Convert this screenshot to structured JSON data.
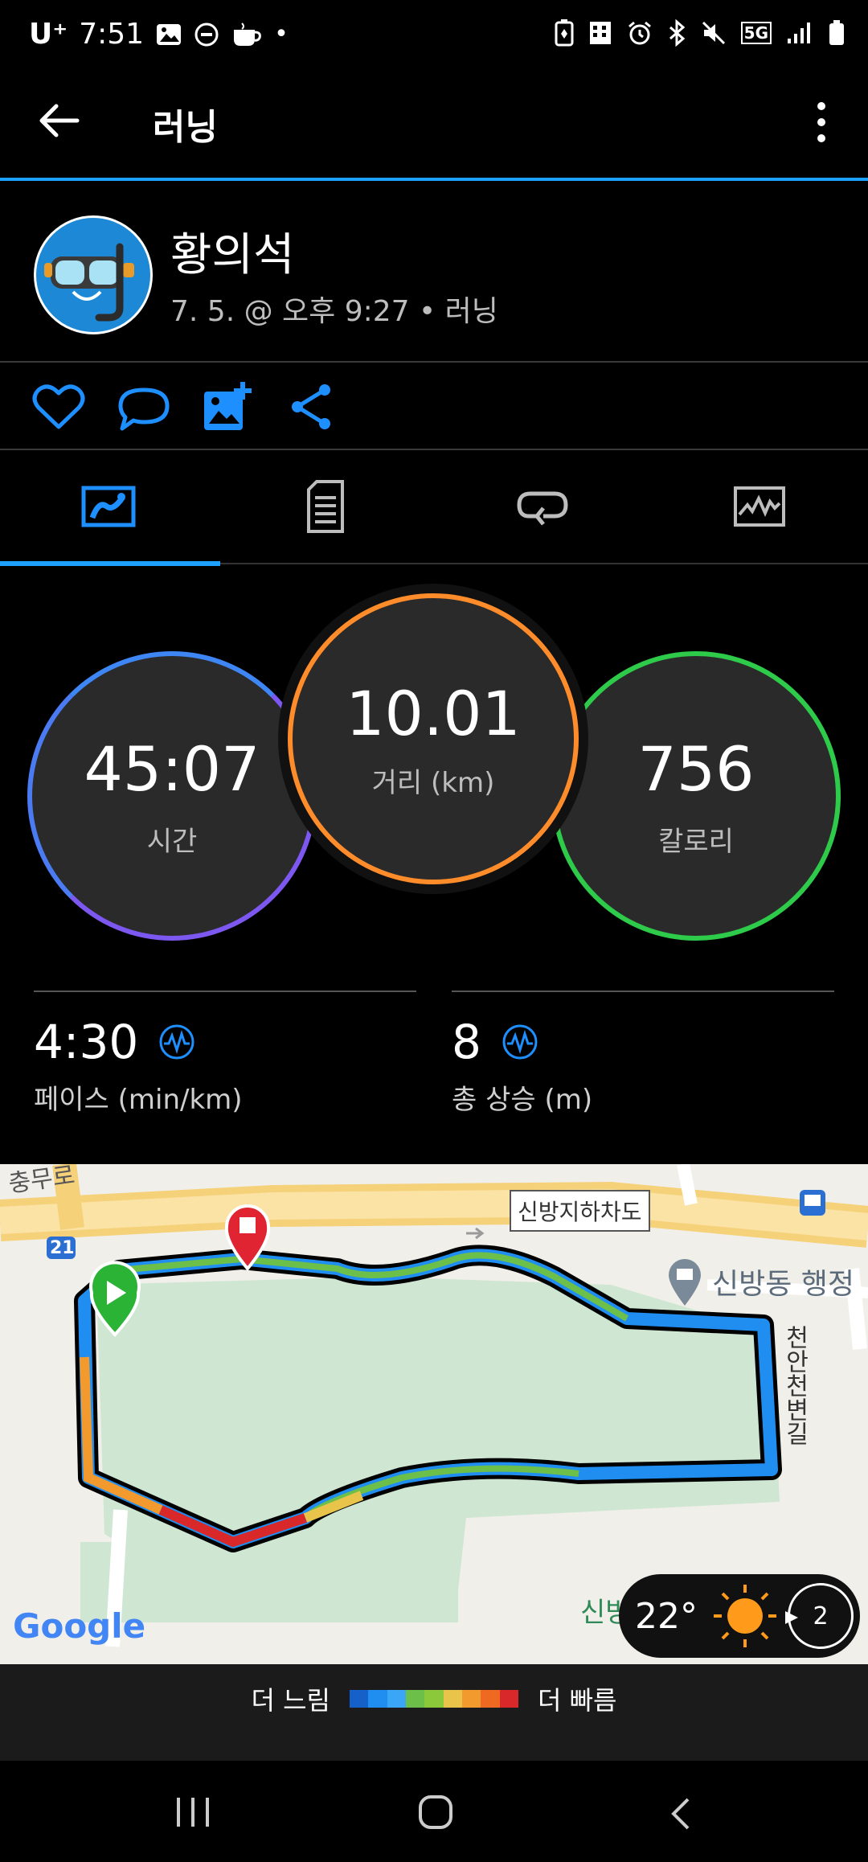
{
  "status_bar": {
    "carrier": "U⁺",
    "time": "7:51",
    "network": "5G"
  },
  "app_bar": {
    "title": "러닝",
    "back_icon": "arrow-left-icon",
    "more_icon": "more-vertical-icon"
  },
  "profile": {
    "name": "황의석",
    "meta": "7. 5. @ 오후 9:27 • 러닝",
    "avatar_icon": "snorkel-mask-icon"
  },
  "actions": {
    "like_icon": "heart-icon",
    "comment_icon": "comment-icon",
    "photo_icon": "add-photo-icon",
    "share_icon": "share-icon"
  },
  "tabs": [
    {
      "icon": "map-summary-icon",
      "active": true
    },
    {
      "icon": "document-icon",
      "active": false
    },
    {
      "icon": "laps-icon",
      "active": false
    },
    {
      "icon": "chart-icon",
      "active": false
    }
  ],
  "metrics": {
    "time": {
      "value": "45:07",
      "label": "시간"
    },
    "distance": {
      "value": "10.01",
      "label": "거리 (km)"
    },
    "calories": {
      "value": "756",
      "label": "칼로리"
    }
  },
  "stats": {
    "pace": {
      "value": "4:30",
      "label": "페이스 (min/km)"
    },
    "ascent": {
      "value": "8",
      "label": "총 상승 (m)"
    }
  },
  "map": {
    "road_label": "신방지하차도",
    "road_number": "21",
    "road_top_left": "충무로",
    "place_label": "신방동 행정",
    "street_label": "천안천변길",
    "bottom_label": "신방",
    "google_logo": "Google",
    "weather": {
      "temp": "22°",
      "wind": "2"
    }
  },
  "legend": {
    "slower": "더 느림",
    "faster": "더 빠름",
    "colors": [
      "#1561c9",
      "#1f8ef0",
      "#3aa6f5",
      "#6cc04a",
      "#8bc83a",
      "#e9c44a",
      "#f29a2e",
      "#ee6a22",
      "#d8282a"
    ]
  },
  "colors": {
    "accent": "#1ea0ff",
    "time_ring": "#7d58f0",
    "distance_ring": "#ff8c2a",
    "calories_ring": "#2ecb4a"
  }
}
